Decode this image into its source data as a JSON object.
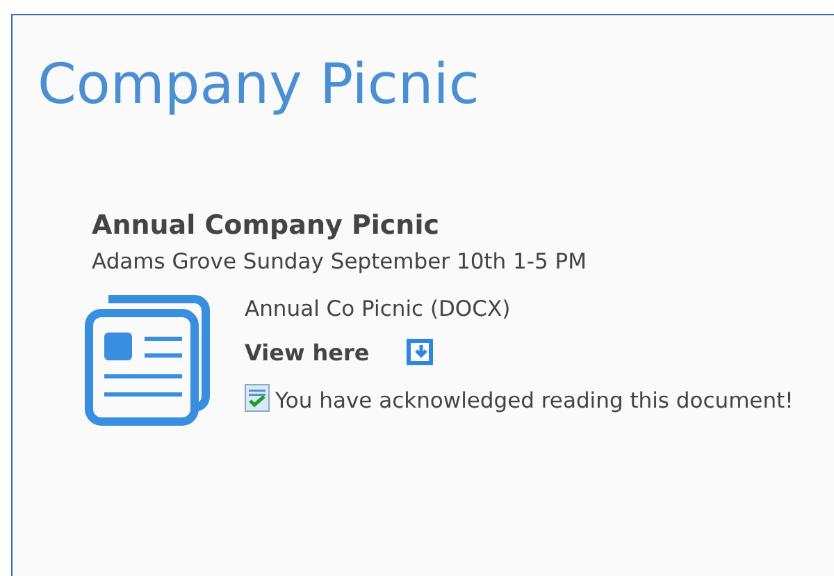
{
  "page": {
    "title": "Company Picnic"
  },
  "item": {
    "title": "Annual Company Picnic",
    "description": "Adams Grove Sunday September 10th 1-5 PM",
    "document": {
      "name": "Annual Co Picnic (DOCX)",
      "link": "View here",
      "acknowledged": true,
      "acknowledgement": "You have acknowledged reading this document!"
    }
  }
}
